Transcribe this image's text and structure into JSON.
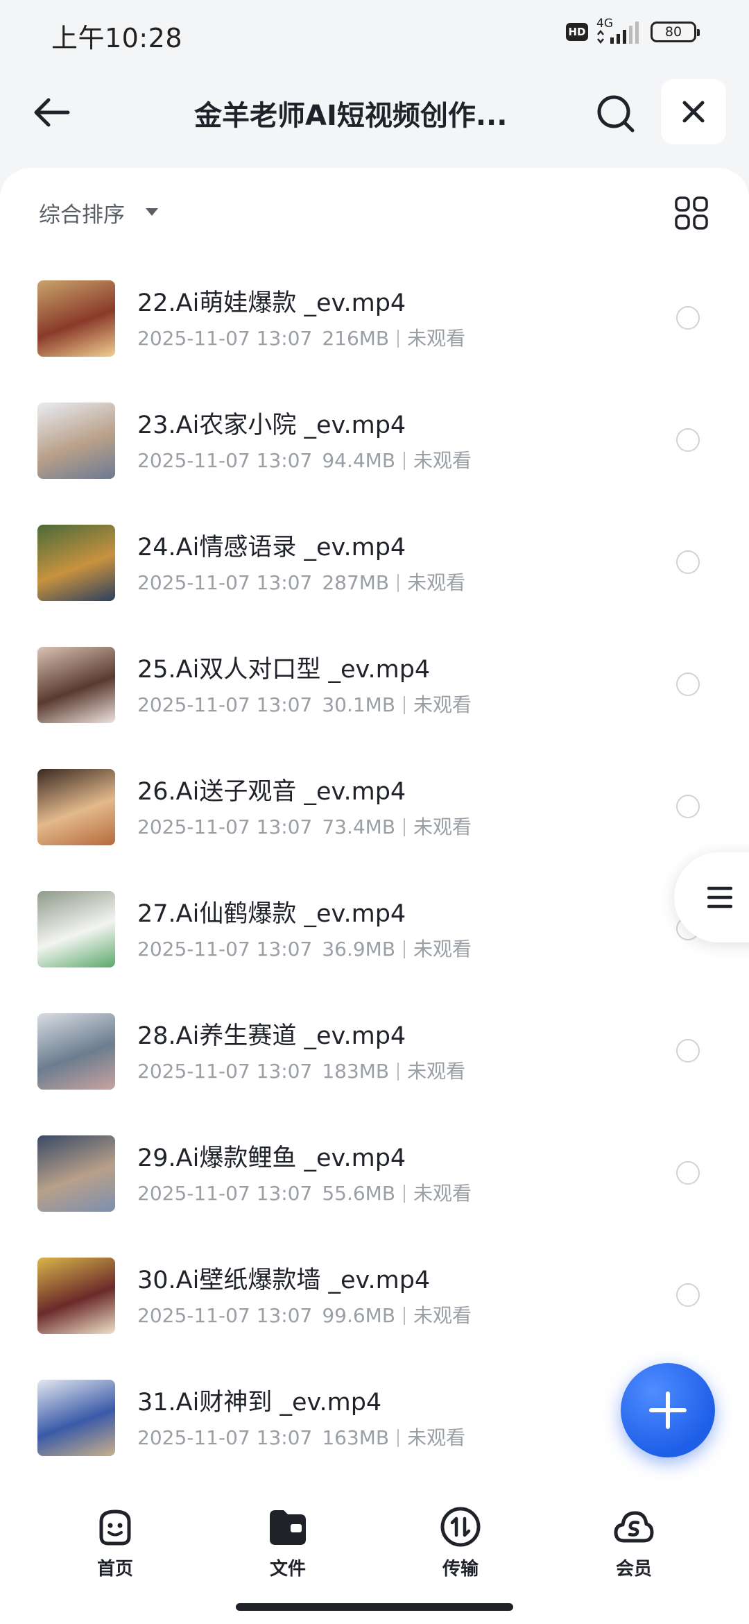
{
  "status_bar": {
    "time": "上午10:28",
    "hd_badge": "HD",
    "network": "4G",
    "battery": "80"
  },
  "header": {
    "title": "金羊老师AI短视频创作...",
    "back_icon": "arrow-left-icon",
    "search_icon": "search-icon",
    "close_icon": "close-icon"
  },
  "sort_bar": {
    "label": "综合排序",
    "view_toggle_icon": "grid-view-icon"
  },
  "files": [
    {
      "name": "22.Ai萌娃爆款 _ev.mp4",
      "date": "2025-11-07 13:07",
      "size": "216MB",
      "status": "未观看",
      "thumb_colors": [
        "#c9a46b",
        "#8a3a2a",
        "#f0d090"
      ]
    },
    {
      "name": "23.Ai农家小院 _ev.mp4",
      "date": "2025-11-07 13:07",
      "size": "94.4MB",
      "status": "未观看",
      "thumb_colors": [
        "#e9ecf2",
        "#b9a089",
        "#6b7a94"
      ]
    },
    {
      "name": "24.Ai情感语录 _ev.mp4",
      "date": "2025-11-07 13:07",
      "size": "287MB",
      "status": "未观看",
      "thumb_colors": [
        "#4a6a3a",
        "#c8923f",
        "#2c3f5e"
      ]
    },
    {
      "name": "25.Ai双人对口型 _ev.mp4",
      "date": "2025-11-07 13:07",
      "size": "30.1MB",
      "status": "未观看",
      "thumb_colors": [
        "#d8c2b4",
        "#5a3a30",
        "#ede4de"
      ]
    },
    {
      "name": "26.Ai送子观音 _ev.mp4",
      "date": "2025-11-07 13:07",
      "size": "73.4MB",
      "status": "未观看",
      "thumb_colors": [
        "#3a2a22",
        "#e3b98c",
        "#b56a3a"
      ]
    },
    {
      "name": "27.Ai仙鹤爆款 _ev.mp4",
      "date": "2025-11-07 13:07",
      "size": "36.9MB",
      "status": "未观看",
      "thumb_colors": [
        "#8f9a8a",
        "#f3f4f1",
        "#5aa86a"
      ]
    },
    {
      "name": "28.Ai养生赛道 _ev.mp4",
      "date": "2025-11-07 13:07",
      "size": "183MB",
      "status": "未观看",
      "thumb_colors": [
        "#d9dce2",
        "#6b7d8f",
        "#c9a3a0"
      ]
    },
    {
      "name": "29.Ai爆款鲤鱼 _ev.mp4",
      "date": "2025-11-07 13:07",
      "size": "55.6MB",
      "status": "未观看",
      "thumb_colors": [
        "#3a4a66",
        "#b8a08a",
        "#7c8fb0"
      ]
    },
    {
      "name": "30.Ai壁纸爆款墙 _ev.mp4",
      "date": "2025-11-07 13:07",
      "size": "99.6MB",
      "status": "未观看",
      "thumb_colors": [
        "#d8b54a",
        "#6a2a2a",
        "#efe1c8"
      ]
    },
    {
      "name": "31.Ai财神到 _ev.mp4",
      "date": "2025-11-07 13:07",
      "size": "163MB",
      "status": "未观看",
      "thumb_colors": [
        "#e3e7ef",
        "#3a5aa8",
        "#c9b08a"
      ]
    }
  ],
  "side_handle_icon": "menu-lines-icon",
  "fab_icon": "plus-icon",
  "bottom_nav": [
    {
      "label": "首页",
      "icon": "smile-face-icon"
    },
    {
      "label": "文件",
      "icon": "folder-icon"
    },
    {
      "label": "传输",
      "icon": "transfer-icon"
    },
    {
      "label": "会员",
      "icon": "cloud-vip-icon"
    }
  ],
  "colors": {
    "accent": "#1f5fe8",
    "text_primary": "#1f2329",
    "text_secondary": "#9a9fa6",
    "background": "#f4f5f7"
  }
}
